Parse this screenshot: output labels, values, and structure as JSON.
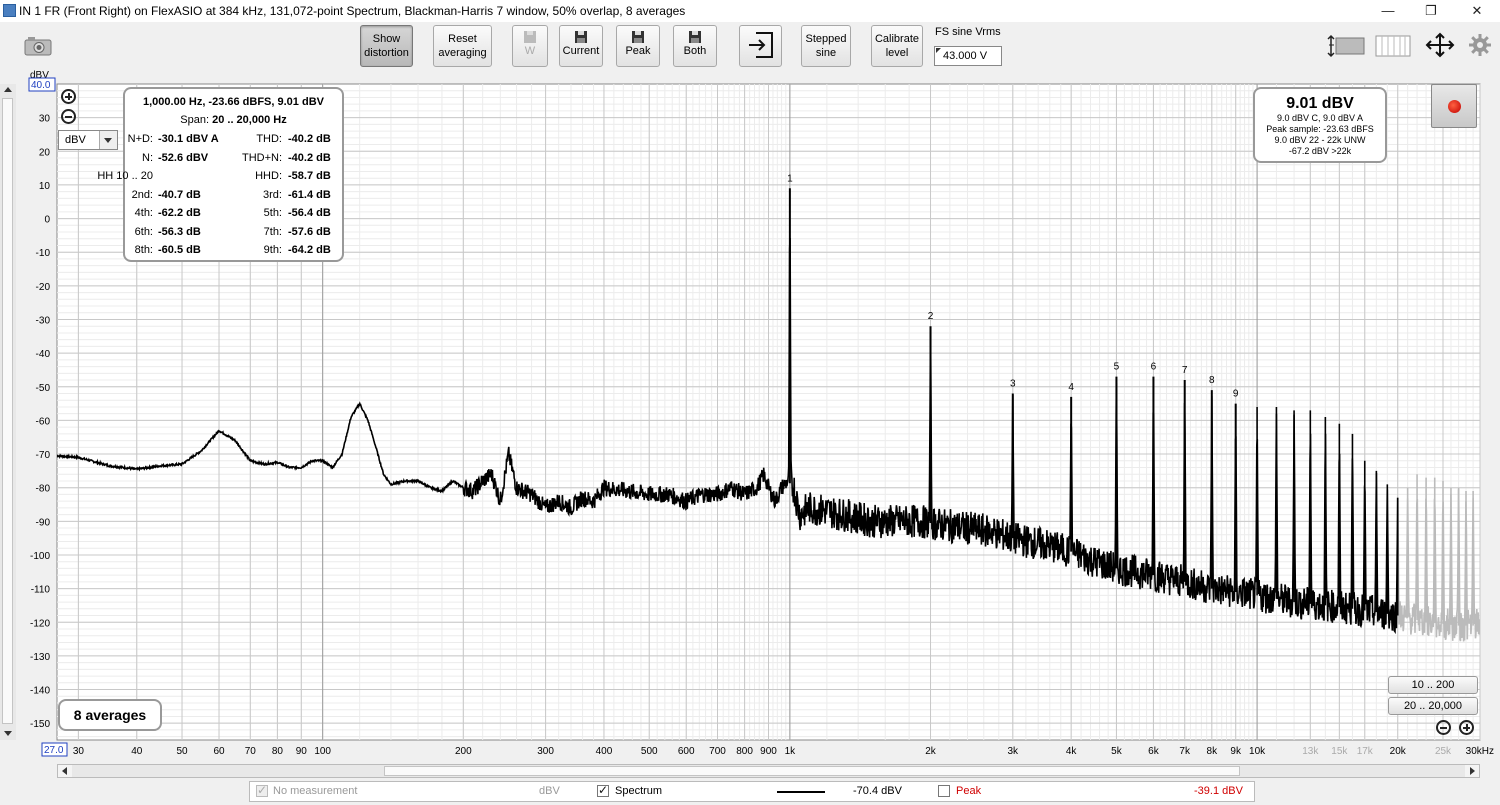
{
  "window": {
    "title": "IN 1 FR (Front Right) on FlexASIO at 384 kHz, 131,072-point Spectrum, Blackman-Harris 7 window, 50% overlap, 8 averages",
    "minimize": "—",
    "maximize": "❐",
    "close": "✕"
  },
  "toolbar": {
    "show_distortion": [
      "Show",
      "distortion"
    ],
    "reset_averaging": [
      "Reset",
      "averaging"
    ],
    "w_label": "W",
    "current": "Current",
    "peak": "Peak",
    "both": "Both",
    "stepped_sine": [
      "Stepped",
      "sine"
    ],
    "calibrate_level": [
      "Calibrate",
      "level"
    ],
    "fs_sine_label": "FS sine Vrms",
    "fs_sine_value": "43.000 V"
  },
  "distortion_panel": {
    "header": "1,000.00 Hz, -23.66 dBFS, 9.01 dBV",
    "span_label": "Span:",
    "span_value": "20 .. 20,000 Hz",
    "rows": [
      {
        "l1": "N+D:",
        "v1": "-30.1 dBV A",
        "l2": "THD:",
        "v2": "-40.2 dB"
      },
      {
        "l1": "N:",
        "v1": "-52.6 dBV",
        "l2": "THD+N:",
        "v2": "-40.2 dB"
      },
      {
        "l1": "HH 10 .. 20",
        "v1": "",
        "l2": "HHD:",
        "v2": "-58.7 dB"
      },
      {
        "l1": "2nd:",
        "v1": "-40.7 dB",
        "l2": "3rd:",
        "v2": "-61.4 dB"
      },
      {
        "l1": "4th:",
        "v1": "-62.2 dB",
        "l2": "5th:",
        "v2": "-56.4 dB"
      },
      {
        "l1": "6th:",
        "v1": "-56.3 dB",
        "l2": "7th:",
        "v2": "-57.6 dB"
      },
      {
        "l1": "8th:",
        "v1": "-60.5 dB",
        "l2": "9th:",
        "v2": "-64.2 dB"
      }
    ]
  },
  "level_panel": {
    "main": "9.01 dBV",
    "lines": [
      "9.0 dBV C, 9.0 dBV A",
      "Peak sample: -23.63 dBFS",
      "9.0 dBV 22 - 22k UNW",
      "-67.2 dBV >22k"
    ]
  },
  "averages_label": "8 averages",
  "unit_selector": "dBV",
  "range_buttons": [
    "10 .. 200",
    "20 .. 20,000"
  ],
  "legend": {
    "no_measurement": "No measurement",
    "no_measurement_unit": "dBV",
    "spectrum": "Spectrum",
    "spectrum_value": "-70.4 dBV",
    "peak": "Peak",
    "peak_value": "-39.1 dBV",
    "peak_color": "#d00000"
  },
  "chart_data": {
    "type": "line",
    "title": "",
    "xlabel": "",
    "ylabel": "dBV",
    "x_scale": "log",
    "xlim": [
      27,
      30000
    ],
    "ylim": [
      -155,
      40
    ],
    "y_top_label": "40.0",
    "x_left_label": "27.0",
    "y_ticks": [
      30,
      20,
      10,
      0,
      -10,
      -20,
      -30,
      -40,
      -50,
      -60,
      -70,
      -80,
      -90,
      -100,
      -110,
      -120,
      -130,
      -140,
      -150
    ],
    "x_ticks": [
      {
        "v": 30,
        "t": "30"
      },
      {
        "v": 40,
        "t": "40"
      },
      {
        "v": 50,
        "t": "50"
      },
      {
        "v": 60,
        "t": "60"
      },
      {
        "v": 70,
        "t": "70"
      },
      {
        "v": 80,
        "t": "80"
      },
      {
        "v": 90,
        "t": "90"
      },
      {
        "v": 100,
        "t": "100"
      },
      {
        "v": 200,
        "t": "200"
      },
      {
        "v": 300,
        "t": "300"
      },
      {
        "v": 400,
        "t": "400"
      },
      {
        "v": 500,
        "t": "500"
      },
      {
        "v": 600,
        "t": "600"
      },
      {
        "v": 700,
        "t": "700"
      },
      {
        "v": 800,
        "t": "800"
      },
      {
        "v": 900,
        "t": "900"
      },
      {
        "v": 1000,
        "t": "1k"
      },
      {
        "v": 2000,
        "t": "2k"
      },
      {
        "v": 3000,
        "t": "3k"
      },
      {
        "v": 4000,
        "t": "4k"
      },
      {
        "v": 5000,
        "t": "5k"
      },
      {
        "v": 6000,
        "t": "6k"
      },
      {
        "v": 7000,
        "t": "7k"
      },
      {
        "v": 8000,
        "t": "8k"
      },
      {
        "v": 9000,
        "t": "9k"
      },
      {
        "v": 10000,
        "t": "10k"
      },
      {
        "v": 13000,
        "t": "13k",
        "grey": true
      },
      {
        "v": 15000,
        "t": "15k",
        "grey": true
      },
      {
        "v": 17000,
        "t": "17k",
        "grey": true
      },
      {
        "v": 20000,
        "t": "20k"
      },
      {
        "v": 25000,
        "t": "25k",
        "grey": true
      },
      {
        "v": 30000,
        "t": "30kHz"
      }
    ],
    "series_color": "#000000",
    "out_of_band_color": "#bbbbbb",
    "harmonics": [
      {
        "n": "1",
        "f": 1000,
        "db": 9
      },
      {
        "n": "2",
        "f": 2000,
        "db": -32
      },
      {
        "n": "3",
        "f": 3000,
        "db": -52
      },
      {
        "n": "4",
        "f": 4000,
        "db": -53
      },
      {
        "n": "5",
        "f": 5000,
        "db": -47
      },
      {
        "n": "6",
        "f": 6000,
        "db": -47
      },
      {
        "n": "7",
        "f": 7000,
        "db": -48
      },
      {
        "n": "8",
        "f": 8000,
        "db": -51
      },
      {
        "n": "9",
        "f": 9000,
        "db": -55
      }
    ],
    "upper_harmonics": [
      {
        "f": 10000,
        "db": -56
      },
      {
        "f": 11000,
        "db": -56
      },
      {
        "f": 12000,
        "db": -57
      },
      {
        "f": 13000,
        "db": -57
      },
      {
        "f": 14000,
        "db": -59
      },
      {
        "f": 15000,
        "db": -61
      },
      {
        "f": 16000,
        "db": -64
      },
      {
        "f": 17000,
        "db": -72
      },
      {
        "f": 18000,
        "db": -75
      },
      {
        "f": 19000,
        "db": -79
      },
      {
        "f": 20000,
        "db": -83
      },
      {
        "f": 21000,
        "db": -80
      },
      {
        "f": 22000,
        "db": -76
      },
      {
        "f": 23000,
        "db": -77
      },
      {
        "f": 24000,
        "db": -77
      },
      {
        "f": 25000,
        "db": -78
      },
      {
        "f": 26000,
        "db": -80
      },
      {
        "f": 27000,
        "db": -80
      },
      {
        "f": 28000,
        "db": -81
      },
      {
        "f": 29000,
        "db": -81
      }
    ],
    "spectrum": [
      [
        27,
        -70.5
      ],
      [
        30,
        -71
      ],
      [
        35,
        -73.5
      ],
      [
        40,
        -74.5
      ],
      [
        45,
        -73.5
      ],
      [
        50,
        -73
      ],
      [
        55,
        -69
      ],
      [
        60,
        -63
      ],
      [
        65,
        -66
      ],
      [
        70,
        -72
      ],
      [
        75,
        -73
      ],
      [
        80,
        -72.5
      ],
      [
        85,
        -74
      ],
      [
        90,
        -74
      ],
      [
        95,
        -72
      ],
      [
        100,
        -72
      ],
      [
        105,
        -74
      ],
      [
        110,
        -70
      ],
      [
        115,
        -59
      ],
      [
        120,
        -55
      ],
      [
        125,
        -60
      ],
      [
        130,
        -68
      ],
      [
        135,
        -76
      ],
      [
        140,
        -79
      ],
      [
        150,
        -78
      ],
      [
        160,
        -78
      ],
      [
        170,
        -80
      ],
      [
        180,
        -81
      ],
      [
        190,
        -78
      ],
      [
        200,
        -80
      ],
      [
        210,
        -81
      ],
      [
        220,
        -78
      ],
      [
        230,
        -76
      ],
      [
        240,
        -84
      ],
      [
        250,
        -70
      ],
      [
        260,
        -80
      ],
      [
        280,
        -82
      ],
      [
        300,
        -86
      ],
      [
        320,
        -84
      ],
      [
        340,
        -86
      ],
      [
        360,
        -83
      ],
      [
        380,
        -84
      ],
      [
        400,
        -80
      ],
      [
        450,
        -81
      ],
      [
        500,
        -82
      ],
      [
        550,
        -82
      ],
      [
        600,
        -84
      ],
      [
        650,
        -82
      ],
      [
        700,
        -82
      ],
      [
        750,
        -80
      ],
      [
        800,
        -82
      ],
      [
        850,
        -80
      ],
      [
        880,
        -76
      ],
      [
        900,
        -80
      ],
      [
        930,
        -84
      ],
      [
        960,
        -80
      ],
      [
        990,
        -78
      ],
      [
        1020,
        -80
      ],
      [
        1050,
        -88
      ],
      [
        1100,
        -86
      ],
      [
        1200,
        -87
      ],
      [
        1300,
        -88
      ],
      [
        1400,
        -89
      ],
      [
        1500,
        -90
      ],
      [
        1700,
        -90
      ],
      [
        1900,
        -90
      ],
      [
        2100,
        -91
      ],
      [
        2400,
        -92
      ],
      [
        2700,
        -93
      ],
      [
        3000,
        -95
      ],
      [
        3500,
        -97
      ],
      [
        4000,
        -99
      ],
      [
        4500,
        -102
      ],
      [
        5000,
        -104
      ],
      [
        5500,
        -105
      ],
      [
        6000,
        -106
      ],
      [
        7000,
        -108
      ],
      [
        8000,
        -110
      ],
      [
        9000,
        -111
      ],
      [
        10000,
        -112
      ],
      [
        12000,
        -114
      ],
      [
        14000,
        -115
      ],
      [
        16000,
        -116
      ],
      [
        18000,
        -117
      ],
      [
        20000,
        -118
      ],
      [
        23000,
        -120
      ],
      [
        27000,
        -121
      ],
      [
        30000,
        -121
      ]
    ]
  }
}
